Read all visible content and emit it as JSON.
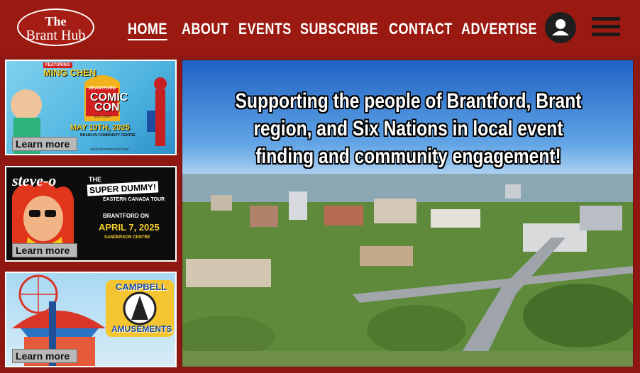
{
  "header": {
    "logo_line1": "The",
    "logo_line2": "Brant Hub",
    "nav": [
      {
        "label": "HOME",
        "active": true
      },
      {
        "label": "ABOUT"
      },
      {
        "label": "EVENTS"
      },
      {
        "label": "SUBSCRIBE"
      },
      {
        "label": "CONTACT"
      },
      {
        "label": "ADVERTISE"
      }
    ],
    "colors": {
      "brand": "#9a1a12",
      "text": "#ffffff"
    },
    "icons": {
      "account": "user-avatar-icon",
      "menu": "hamburger-menu-icon"
    }
  },
  "ads": [
    {
      "featuring": "FEATURING",
      "guest": "MING CHEN",
      "brand_top": "BRANTFORD",
      "brand_main1": "COMIC",
      "brand_main2": "CON",
      "est": "EST. 2024",
      "date": "MAY 10TH, 2025",
      "venue": "BRANLYN COMMUNITY CENTRE",
      "url": "@BRANTFORDCON.COM",
      "cta": "Learn more"
    },
    {
      "performer": "steve-o",
      "tour1": "THE",
      "tour2": "SUPER DUMMY!",
      "tour3": "EASTERN CANADA TOUR",
      "city": "BRANTFORD ON",
      "date": "APRIL 7, 2025",
      "venue": "SANDERSON CENTRE",
      "cta": "Learn more"
    },
    {
      "brand1": "CAMPBELL",
      "brand2": "AMUSEMENTS",
      "cta": "Learn more"
    }
  ],
  "hero": {
    "headline": "Supporting the people of Brantford, Brant region, and Six Nations in local event finding and community engagement!"
  }
}
